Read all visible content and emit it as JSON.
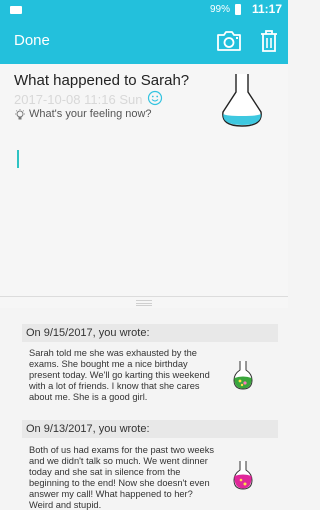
{
  "status_bar": {
    "battery": "99%",
    "time": "11:17"
  },
  "toolbar": {
    "done_label": "Done"
  },
  "note": {
    "title": "What happened to Sarah?",
    "date": "2017-10-08 11:16",
    "day": "Sun",
    "feeling_prompt": "What's your feeling now?"
  },
  "history": [
    {
      "header": "On 9/15/2017, you wrote:",
      "text": "Sarah told me she was exhausted by the exams. She bought me a nice birthday present today. We'll go karting this weekend with a lot of friends. I know that she cares about me. She is a good girl.",
      "flask_color": "#3aa63c"
    },
    {
      "header": "On 9/13/2017, you wrote:",
      "text": "Both of us had exams for the past two weeks and we didn't talk so much. We went dinner today and she sat in silence from the beginning to the end! Now she doesn't even answer my call! What happened to her? Weird and stupid.",
      "flask_color": "#e0279a"
    }
  ],
  "colors": {
    "accent": "#23c0dc",
    "flask_liquid": "#3ec8e0"
  }
}
